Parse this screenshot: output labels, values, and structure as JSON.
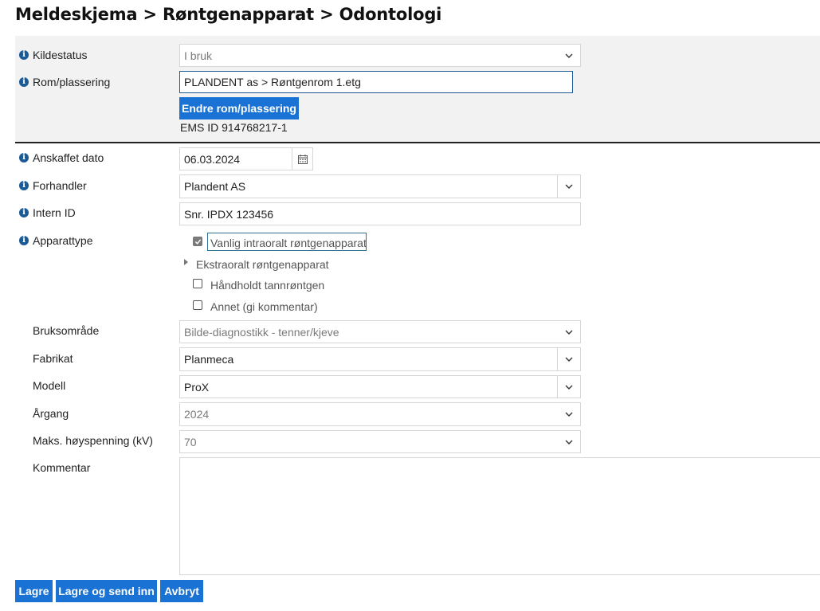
{
  "page": {
    "title": "Meldeskjema > Røntgenapparat > Odontologi"
  },
  "top_section": {
    "kildestatus": {
      "label": "Kildestatus",
      "value": "I bruk"
    },
    "rom_plassering": {
      "label": "Rom/plassering",
      "value": "PLANDENT as > Røntgenrom 1.etg"
    },
    "change_button": "Endre rom/plassering",
    "ems_id": "EMS ID 914768217-1"
  },
  "form": {
    "anskaffet_dato": {
      "label": "Anskaffet dato",
      "value": "06.03.2024"
    },
    "forhandler": {
      "label": "Forhandler",
      "value": "Plandent AS"
    },
    "intern_id": {
      "label": "Intern ID",
      "value": "Snr. IPDX 123456"
    },
    "apparattype": {
      "label": "Apparattype",
      "options": [
        {
          "label": "Vanlig intraoralt røntgenapparat",
          "checked": true
        },
        {
          "label": "Ekstraoralt røntgenapparat",
          "expandable": true
        },
        {
          "label": "Håndholdt tannrøntgen",
          "checked": false
        },
        {
          "label": "Annet (gi kommentar)",
          "checked": false
        }
      ]
    },
    "bruksomrade": {
      "label": "Bruksområde",
      "value": "Bilde-diagnostikk - tenner/kjeve"
    },
    "fabrikat": {
      "label": "Fabrikat",
      "value": "Planmeca"
    },
    "modell": {
      "label": "Modell",
      "value": "ProX"
    },
    "argang": {
      "label": "Årgang",
      "value": "2024"
    },
    "maks_hoyspenning": {
      "label": "Maks. høyspenning (kV)",
      "value": "70"
    },
    "kommentar": {
      "label": "Kommentar",
      "value": ""
    }
  },
  "actions": {
    "save": "Lagre",
    "save_submit": "Lagre og send inn",
    "cancel": "Avbryt"
  },
  "colors": {
    "primary": "#1a73d4",
    "info_icon": "#1a5a96",
    "panel_bg": "#f2f2f2"
  },
  "icons": {
    "info": "info-icon",
    "dropdown": "chevron-down-icon",
    "calendar": "calendar-icon",
    "expand": "caret-right-icon",
    "check": "checkmark-icon"
  }
}
